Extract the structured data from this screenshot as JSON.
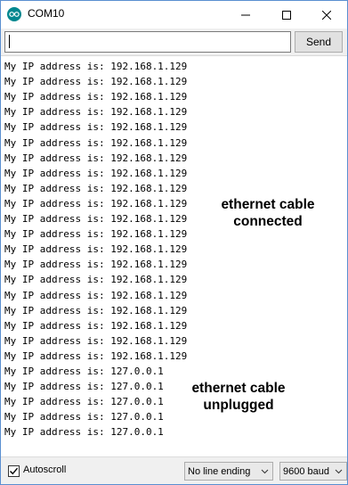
{
  "window": {
    "title": "COM10",
    "app_icon": "arduino-icon",
    "controls": [
      "minimize-icon",
      "maximize-icon",
      "close-icon"
    ]
  },
  "input": {
    "value": "",
    "send_label": "Send"
  },
  "output": {
    "lines": [
      "My IP address is: 192.168.1.129",
      "My IP address is: 192.168.1.129",
      "My IP address is: 192.168.1.129",
      "My IP address is: 192.168.1.129",
      "My IP address is: 192.168.1.129",
      "My IP address is: 192.168.1.129",
      "My IP address is: 192.168.1.129",
      "My IP address is: 192.168.1.129",
      "My IP address is: 192.168.1.129",
      "My IP address is: 192.168.1.129",
      "My IP address is: 192.168.1.129",
      "My IP address is: 192.168.1.129",
      "My IP address is: 192.168.1.129",
      "My IP address is: 192.168.1.129",
      "My IP address is: 192.168.1.129",
      "My IP address is: 192.168.1.129",
      "My IP address is: 192.168.1.129",
      "My IP address is: 192.168.1.129",
      "My IP address is: 192.168.1.129",
      "My IP address is: 192.168.1.129",
      "My IP address is: 127.0.0.1",
      "My IP address is: 127.0.0.1",
      "My IP address is: 127.0.0.1",
      "My IP address is: 127.0.0.1",
      "My IP address is: 127.0.0.1"
    ],
    "annotations": [
      {
        "line1": "ethernet cable",
        "line2": "connected"
      },
      {
        "line1": "ethernet cable",
        "line2": "unplugged"
      }
    ]
  },
  "footer": {
    "autoscroll_label": "Autoscroll",
    "autoscroll_checked": true,
    "line_ending": "No line ending",
    "baud": "9600 baud"
  },
  "colors": {
    "title_bar": "#ffffff",
    "chrome": "#f0f0f0",
    "accent": "#00878f"
  }
}
